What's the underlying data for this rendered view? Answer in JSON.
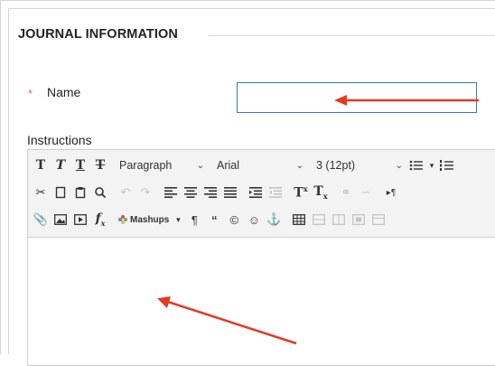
{
  "section": {
    "title": "JOURNAL INFORMATION"
  },
  "name_field": {
    "required_marker": "*",
    "label": "Name",
    "value": ""
  },
  "instructions": {
    "label": "Instructions",
    "toolbar": {
      "format_dropdown": "Paragraph",
      "font_dropdown": "Arial",
      "size_dropdown": "3 (12pt)",
      "mashups_label": "Mashups",
      "bold_glyph": "T",
      "italic_glyph": "T",
      "underline_glyph": "T",
      "strike_glyph": "T"
    },
    "content": ""
  },
  "colors": {
    "accent_blue": "#2e7bc7",
    "required_orange": "#e0703d",
    "annotation_red": "#e63a22"
  },
  "icons": [
    "cut-icon",
    "copy-icon",
    "paste-icon",
    "search-icon",
    "undo-icon",
    "redo-icon",
    "align-left-icon",
    "align-center-icon",
    "align-right-icon",
    "justify-icon",
    "indent-icon",
    "outdent-icon",
    "superscript-icon",
    "subscript-icon",
    "link-icon",
    "unlink-icon",
    "ltr-icon",
    "attach-icon",
    "image-icon",
    "media-icon",
    "formula-icon",
    "paragraph-mark-icon",
    "quote-icon",
    "copyright-icon",
    "emoji-icon",
    "anchor-icon",
    "table-icon"
  ]
}
